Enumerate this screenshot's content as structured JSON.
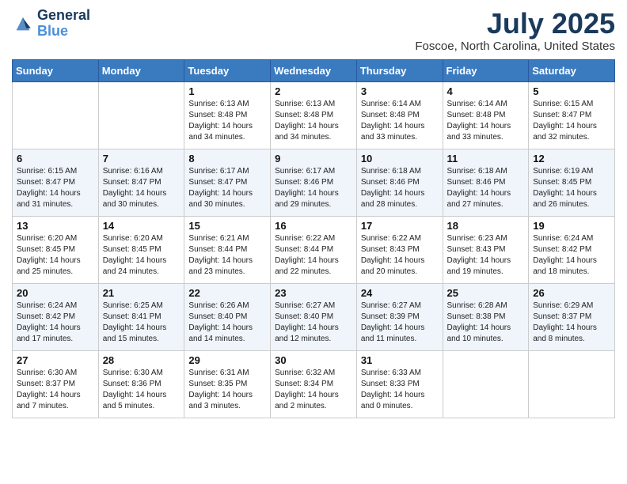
{
  "header": {
    "logo_line1": "General",
    "logo_line2": "Blue",
    "month_year": "July 2025",
    "location": "Foscoe, North Carolina, United States"
  },
  "weekdays": [
    "Sunday",
    "Monday",
    "Tuesday",
    "Wednesday",
    "Thursday",
    "Friday",
    "Saturday"
  ],
  "weeks": [
    [
      {
        "day": "",
        "info": ""
      },
      {
        "day": "",
        "info": ""
      },
      {
        "day": "1",
        "info": "Sunrise: 6:13 AM\nSunset: 8:48 PM\nDaylight: 14 hours and 34 minutes."
      },
      {
        "day": "2",
        "info": "Sunrise: 6:13 AM\nSunset: 8:48 PM\nDaylight: 14 hours and 34 minutes."
      },
      {
        "day": "3",
        "info": "Sunrise: 6:14 AM\nSunset: 8:48 PM\nDaylight: 14 hours and 33 minutes."
      },
      {
        "day": "4",
        "info": "Sunrise: 6:14 AM\nSunset: 8:48 PM\nDaylight: 14 hours and 33 minutes."
      },
      {
        "day": "5",
        "info": "Sunrise: 6:15 AM\nSunset: 8:47 PM\nDaylight: 14 hours and 32 minutes."
      }
    ],
    [
      {
        "day": "6",
        "info": "Sunrise: 6:15 AM\nSunset: 8:47 PM\nDaylight: 14 hours and 31 minutes."
      },
      {
        "day": "7",
        "info": "Sunrise: 6:16 AM\nSunset: 8:47 PM\nDaylight: 14 hours and 30 minutes."
      },
      {
        "day": "8",
        "info": "Sunrise: 6:17 AM\nSunset: 8:47 PM\nDaylight: 14 hours and 30 minutes."
      },
      {
        "day": "9",
        "info": "Sunrise: 6:17 AM\nSunset: 8:46 PM\nDaylight: 14 hours and 29 minutes."
      },
      {
        "day": "10",
        "info": "Sunrise: 6:18 AM\nSunset: 8:46 PM\nDaylight: 14 hours and 28 minutes."
      },
      {
        "day": "11",
        "info": "Sunrise: 6:18 AM\nSunset: 8:46 PM\nDaylight: 14 hours and 27 minutes."
      },
      {
        "day": "12",
        "info": "Sunrise: 6:19 AM\nSunset: 8:45 PM\nDaylight: 14 hours and 26 minutes."
      }
    ],
    [
      {
        "day": "13",
        "info": "Sunrise: 6:20 AM\nSunset: 8:45 PM\nDaylight: 14 hours and 25 minutes."
      },
      {
        "day": "14",
        "info": "Sunrise: 6:20 AM\nSunset: 8:45 PM\nDaylight: 14 hours and 24 minutes."
      },
      {
        "day": "15",
        "info": "Sunrise: 6:21 AM\nSunset: 8:44 PM\nDaylight: 14 hours and 23 minutes."
      },
      {
        "day": "16",
        "info": "Sunrise: 6:22 AM\nSunset: 8:44 PM\nDaylight: 14 hours and 22 minutes."
      },
      {
        "day": "17",
        "info": "Sunrise: 6:22 AM\nSunset: 8:43 PM\nDaylight: 14 hours and 20 minutes."
      },
      {
        "day": "18",
        "info": "Sunrise: 6:23 AM\nSunset: 8:43 PM\nDaylight: 14 hours and 19 minutes."
      },
      {
        "day": "19",
        "info": "Sunrise: 6:24 AM\nSunset: 8:42 PM\nDaylight: 14 hours and 18 minutes."
      }
    ],
    [
      {
        "day": "20",
        "info": "Sunrise: 6:24 AM\nSunset: 8:42 PM\nDaylight: 14 hours and 17 minutes."
      },
      {
        "day": "21",
        "info": "Sunrise: 6:25 AM\nSunset: 8:41 PM\nDaylight: 14 hours and 15 minutes."
      },
      {
        "day": "22",
        "info": "Sunrise: 6:26 AM\nSunset: 8:40 PM\nDaylight: 14 hours and 14 minutes."
      },
      {
        "day": "23",
        "info": "Sunrise: 6:27 AM\nSunset: 8:40 PM\nDaylight: 14 hours and 12 minutes."
      },
      {
        "day": "24",
        "info": "Sunrise: 6:27 AM\nSunset: 8:39 PM\nDaylight: 14 hours and 11 minutes."
      },
      {
        "day": "25",
        "info": "Sunrise: 6:28 AM\nSunset: 8:38 PM\nDaylight: 14 hours and 10 minutes."
      },
      {
        "day": "26",
        "info": "Sunrise: 6:29 AM\nSunset: 8:37 PM\nDaylight: 14 hours and 8 minutes."
      }
    ],
    [
      {
        "day": "27",
        "info": "Sunrise: 6:30 AM\nSunset: 8:37 PM\nDaylight: 14 hours and 7 minutes."
      },
      {
        "day": "28",
        "info": "Sunrise: 6:30 AM\nSunset: 8:36 PM\nDaylight: 14 hours and 5 minutes."
      },
      {
        "day": "29",
        "info": "Sunrise: 6:31 AM\nSunset: 8:35 PM\nDaylight: 14 hours and 3 minutes."
      },
      {
        "day": "30",
        "info": "Sunrise: 6:32 AM\nSunset: 8:34 PM\nDaylight: 14 hours and 2 minutes."
      },
      {
        "day": "31",
        "info": "Sunrise: 6:33 AM\nSunset: 8:33 PM\nDaylight: 14 hours and 0 minutes."
      },
      {
        "day": "",
        "info": ""
      },
      {
        "day": "",
        "info": ""
      }
    ]
  ]
}
